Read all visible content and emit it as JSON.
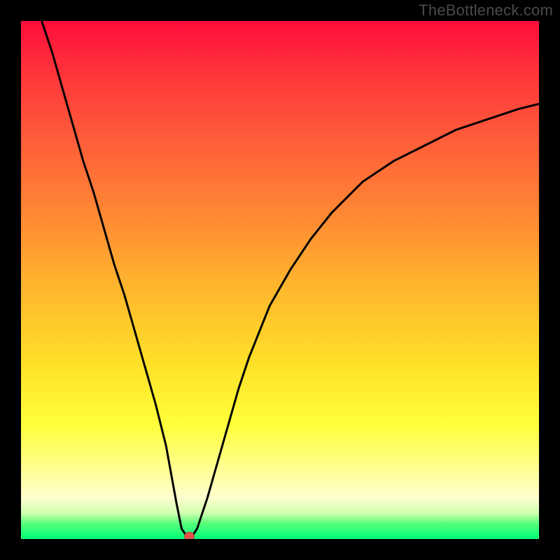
{
  "watermark": "TheBottleneck.com",
  "chart_data": {
    "type": "line",
    "title": "",
    "xlabel": "",
    "ylabel": "",
    "xlim": [
      0,
      100
    ],
    "ylim": [
      0,
      100
    ],
    "grid": false,
    "legend": false,
    "description": "Bottleneck V-curve against a red-to-green vertical gradient. A black curve descends steeply and nearly linearly from the top-left to a minimum near the bottom, then rises back up asymptotically toward the right edge. A red marker dot sits at the minimum. Lower values at the bottom correspond to the green band (optimal).",
    "series": [
      {
        "name": "bottleneck-curve",
        "x": [
          4,
          6,
          8,
          10,
          12,
          14,
          16,
          18,
          20,
          22,
          24,
          26,
          28,
          30,
          31,
          32,
          33,
          34,
          36,
          38,
          40,
          42,
          44,
          48,
          52,
          56,
          60,
          66,
          72,
          78,
          84,
          90,
          96,
          100
        ],
        "y": [
          100,
          94,
          87,
          80,
          73,
          67,
          60,
          53,
          47,
          40,
          33,
          26,
          18,
          7,
          2,
          0.5,
          0.5,
          2,
          8,
          15,
          22,
          29,
          35,
          45,
          52,
          58,
          63,
          69,
          73,
          76,
          79,
          81,
          83,
          84
        ]
      }
    ],
    "marker": {
      "x": 32.5,
      "y": 0.5,
      "color": "#e05448"
    }
  },
  "gradient_colors": {
    "top": "#ff0d3a",
    "mid_upper": "#ff8a33",
    "mid": "#ffe028",
    "lower": "#ffff8e",
    "bottom": "#00ff7a"
  }
}
